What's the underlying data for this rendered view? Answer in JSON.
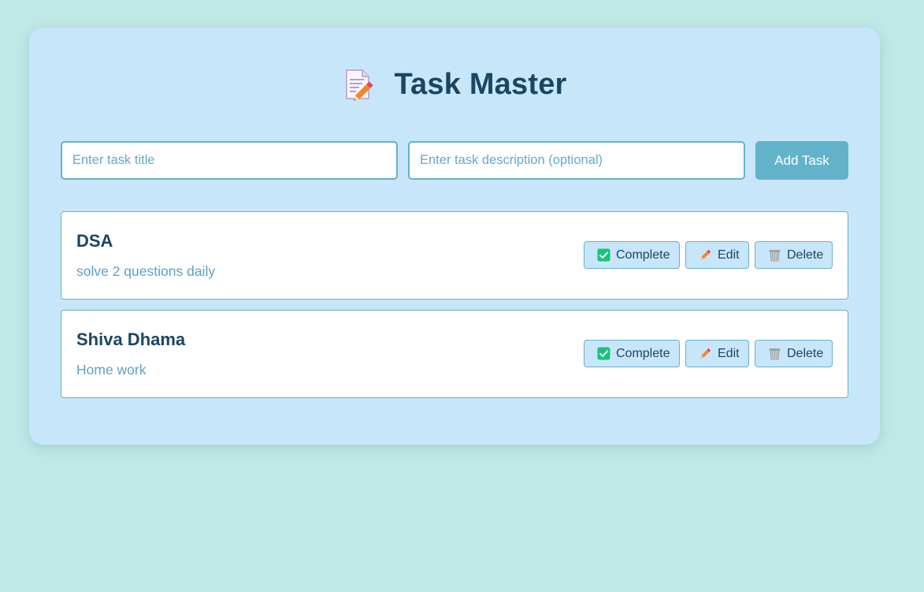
{
  "app": {
    "title": "Task Master",
    "title_icon": "memo-pencil-icon"
  },
  "form": {
    "title_placeholder": "Enter task title",
    "title_value": "",
    "description_placeholder": "Enter task description (optional)",
    "description_value": "",
    "add_label": "Add Task"
  },
  "tasks": [
    {
      "title": "DSA",
      "description": "solve 2 questions daily",
      "complete_label": "Complete",
      "edit_label": "Edit",
      "delete_label": "Delete"
    },
    {
      "title": "Shiva Dhama",
      "description": "Home work",
      "complete_label": "Complete",
      "edit_label": "Edit",
      "delete_label": "Delete"
    }
  ],
  "colors": {
    "background": "#bfe8e6",
    "card": "#c8e6fa",
    "primary_text": "#1b4662",
    "accent": "#62b3c9",
    "description_text": "#5fa0c8",
    "check_green": "#19c37d",
    "pencil_orange": "#f4862c"
  }
}
